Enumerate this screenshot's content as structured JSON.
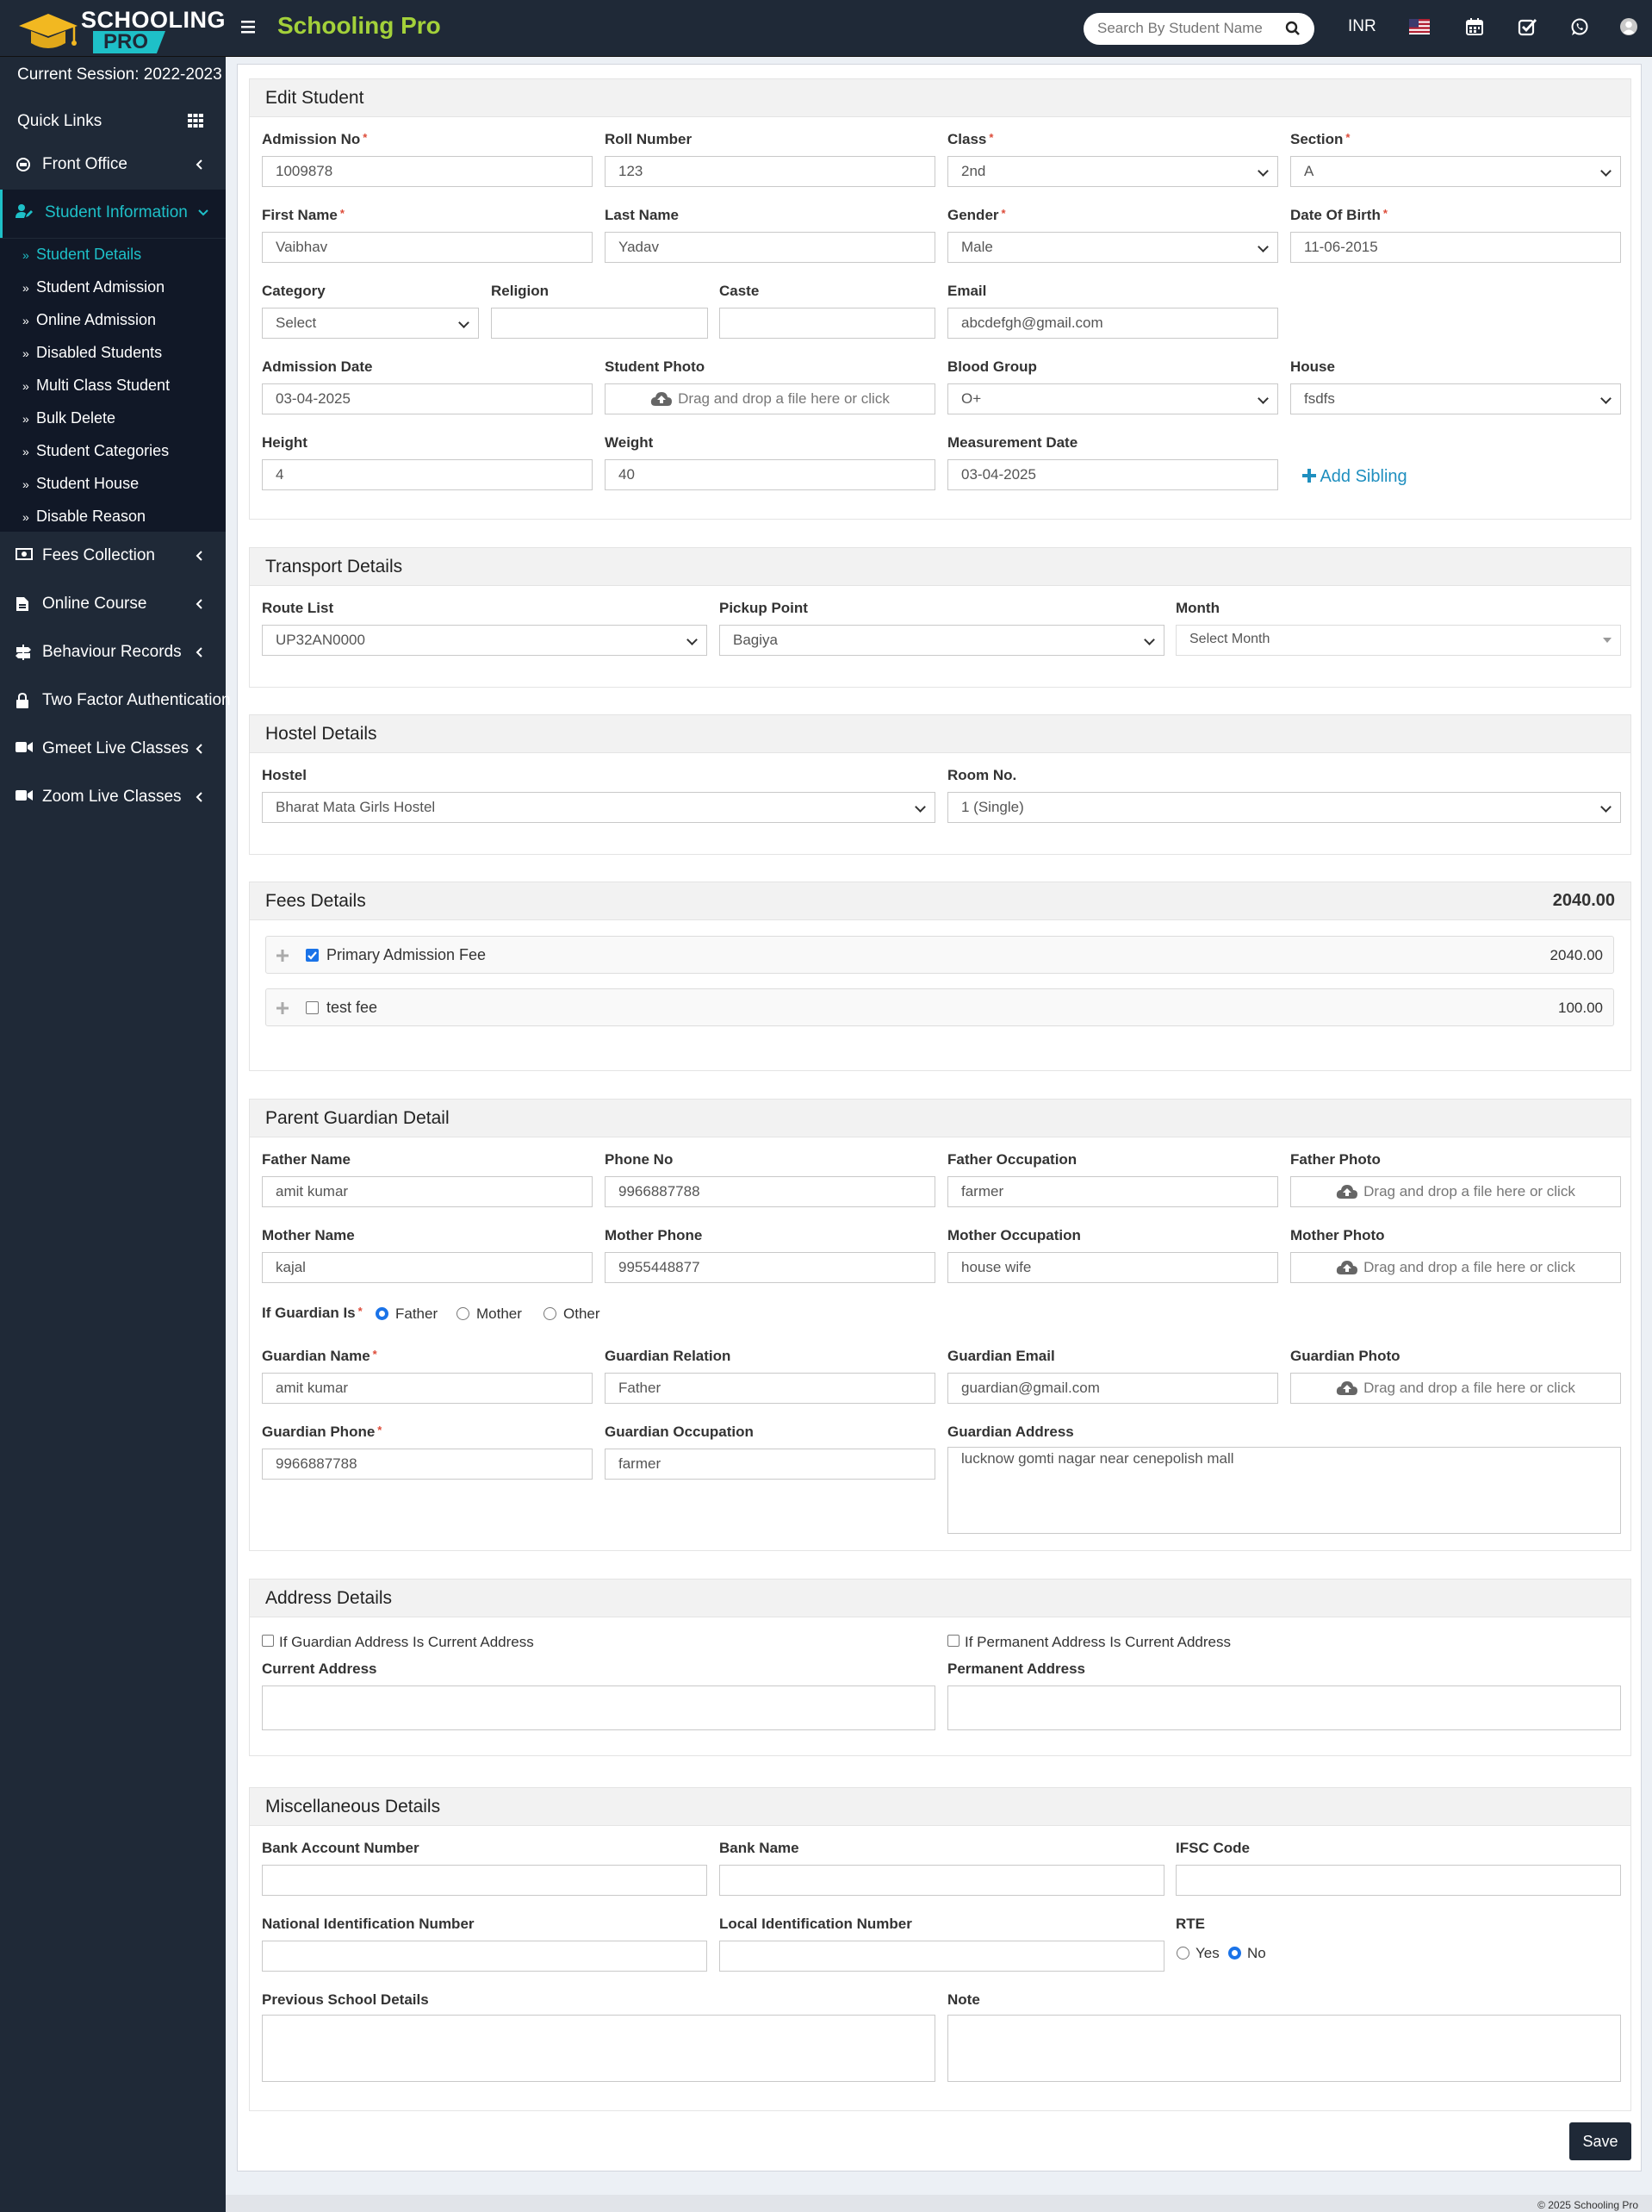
{
  "app": {
    "logo_line1": "SCHOOLING",
    "logo_line2": "PRO",
    "brand": "Schooling Pro",
    "search_placeholder": "Search By Student Name",
    "currency": "INR"
  },
  "sidebar": {
    "session": "Current Session: 2022-2023",
    "quick_links": "Quick Links",
    "front_office": "Front Office",
    "student_information": "Student Information",
    "sub_items": [
      "Student Details",
      "Student Admission",
      "Online Admission",
      "Disabled Students",
      "Multi Class Student",
      "Bulk Delete",
      "Student Categories",
      "Student House",
      "Disable Reason"
    ],
    "fees_collection": "Fees Collection",
    "online_course": "Online Course",
    "behaviour_records": "Behaviour Records",
    "two_factor": "Two Factor Authentication",
    "gmeet": "Gmeet Live Classes",
    "zoom": "Zoom Live Classes"
  },
  "edit": {
    "title": "Edit Student",
    "admission_no_label": "Admission No",
    "admission_no": "1009878",
    "roll_label": "Roll Number",
    "roll": "123",
    "class_label": "Class",
    "class": "2nd",
    "section_label": "Section",
    "section": "A",
    "first_name_label": "First Name",
    "first_name": "Vaibhav",
    "last_name_label": "Last Name",
    "last_name": "Yadav",
    "gender_label": "Gender",
    "gender": "Male",
    "dob_label": "Date Of Birth",
    "dob": "11-06-2015",
    "category_label": "Category",
    "category": "Select",
    "religion_label": "Religion",
    "caste_label": "Caste",
    "email_label": "Email",
    "email": "abcdefgh@gmail.com",
    "admission_date_label": "Admission Date",
    "admission_date": "03-04-2025",
    "photo_label": "Student Photo",
    "dropzone": "Drag and drop a file here or click",
    "blood_label": "Blood Group",
    "blood": "O+",
    "house_label": "House",
    "house": "fsdfs",
    "height_label": "Height",
    "height": "4",
    "weight_label": "Weight",
    "weight": "40",
    "measure_label": "Measurement Date",
    "measure": "03-04-2025",
    "add_sibling": "Add Sibling"
  },
  "transport": {
    "title": "Transport Details",
    "route_label": "Route List",
    "route": "UP32AN0000",
    "pickup_label": "Pickup Point",
    "pickup": "Bagiya",
    "month_label": "Month",
    "month": "Select Month"
  },
  "hostel": {
    "title": "Hostel Details",
    "hostel_label": "Hostel",
    "hostel": "Bharat Mata Girls Hostel",
    "room_label": "Room No.",
    "room": "1 (Single)"
  },
  "fees": {
    "title": "Fees Details",
    "total": "2040.00",
    "items": [
      {
        "name": "Primary Admission Fee",
        "amount": "2040.00",
        "checked": true
      },
      {
        "name": "test fee",
        "amount": "100.00",
        "checked": false
      }
    ]
  },
  "parent": {
    "title": "Parent Guardian Detail",
    "father_name_label": "Father Name",
    "father_name": "amit kumar",
    "phone_label": "Phone No",
    "phone": "9966887788",
    "father_occ_label": "Father Occupation",
    "father_occ": "farmer",
    "father_photo_label": "Father Photo",
    "mother_name_label": "Mother Name",
    "mother_name": "kajal",
    "mother_phone_label": "Mother Phone",
    "mother_phone": "9955448877",
    "mother_occ_label": "Mother Occupation",
    "mother_occ": "house wife",
    "mother_photo_label": "Mother Photo",
    "guardian_is_label": "If Guardian Is",
    "opt_father": "Father",
    "opt_mother": "Mother",
    "opt_other": "Other",
    "guardian_name_label": "Guardian Name",
    "guardian_name": "amit kumar",
    "guardian_rel_label": "Guardian Relation",
    "guardian_rel": "Father",
    "guardian_email_label": "Guardian Email",
    "guardian_email": "guardian@gmail.com",
    "guardian_photo_label": "Guardian Photo",
    "guardian_phone_label": "Guardian Phone",
    "guardian_phone": "9966887788",
    "guardian_occ_label": "Guardian Occupation",
    "guardian_occ": "farmer",
    "guardian_addr_label": "Guardian Address",
    "guardian_addr": "lucknow gomti nagar near cenepolish mall"
  },
  "address": {
    "title": "Address Details",
    "cb_guardian": "If Guardian Address Is Current Address",
    "cb_permanent": "If Permanent Address Is Current Address",
    "current_label": "Current Address",
    "permanent_label": "Permanent Address"
  },
  "misc": {
    "title": "Miscellaneous Details",
    "bank_acc_label": "Bank Account Number",
    "bank_name_label": "Bank Name",
    "ifsc_label": "IFSC Code",
    "nid_label": "National Identification Number",
    "lid_label": "Local Identification Number",
    "rte_label": "RTE",
    "rte_yes": "Yes",
    "rte_no": "No",
    "prev_school_label": "Previous School Details",
    "note_label": "Note"
  },
  "save": "Save",
  "footer": "© 2025 Schooling Pro"
}
